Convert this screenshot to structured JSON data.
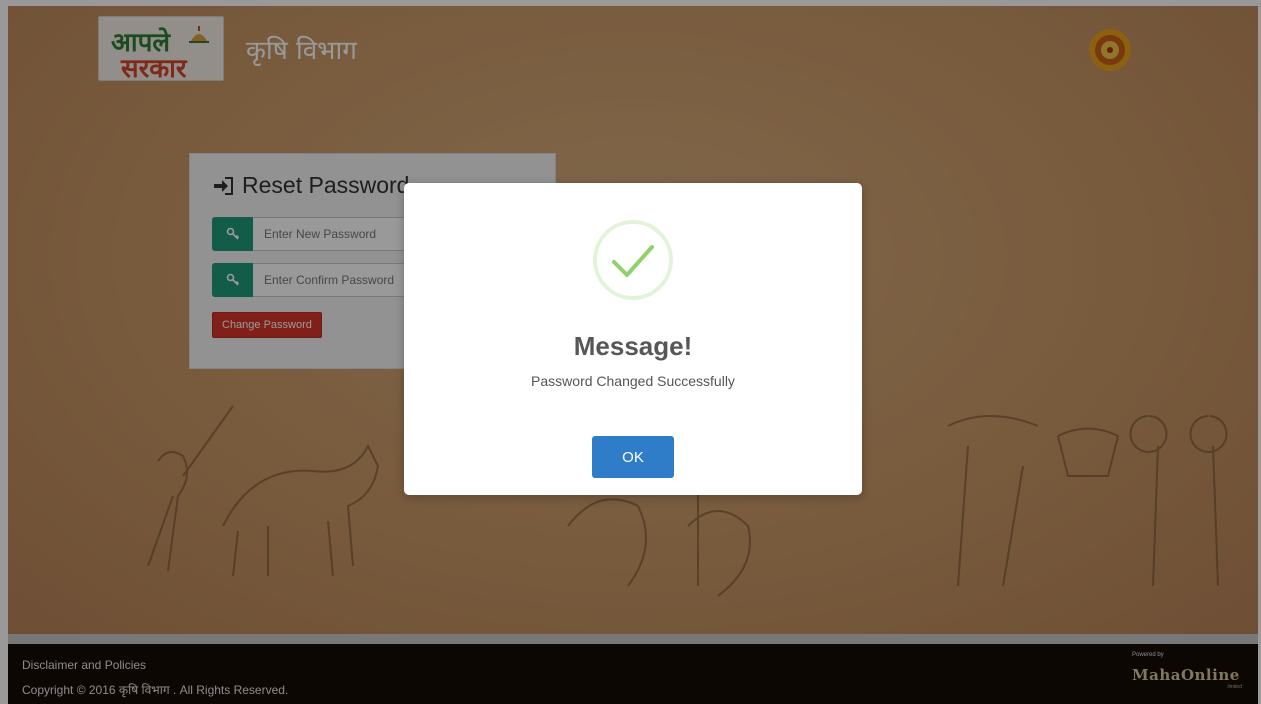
{
  "header": {
    "logo_line1": "आपले",
    "logo_line2": "सरकार",
    "department": "कृषि विभाग"
  },
  "panel": {
    "title": "Reset Password",
    "new_password_placeholder": "Enter New Password",
    "confirm_password_placeholder": "Enter Confirm Password",
    "change_button": "Change Password"
  },
  "modal": {
    "title": "Message!",
    "text": "Password Changed Successfully",
    "ok_button": "OK"
  },
  "footer": {
    "disclaimer": "Disclaimer and Policies",
    "copyright": "Copyright © 2016 कृषि विभाग . All Rights Reserved.",
    "powered_small": "Powered by",
    "powered_brand": "MahaOnline",
    "powered_sub": "limited"
  },
  "colors": {
    "accent_green": "#1f9a7a",
    "danger_red": "#d6362a",
    "primary_blue": "#2f7dc8",
    "success_green": "#8fd16a",
    "footer_bg": "#160c08"
  }
}
